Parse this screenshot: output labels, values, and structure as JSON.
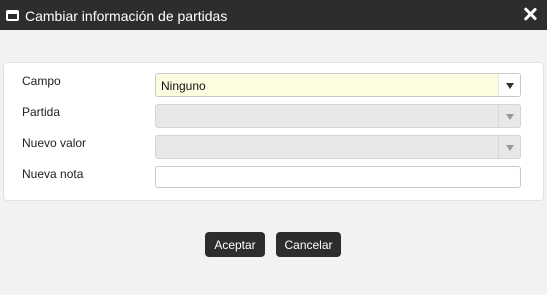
{
  "dialog": {
    "title": "Cambiar información de partidas"
  },
  "form": {
    "campo": {
      "label": "Campo",
      "value": "Ninguno"
    },
    "partida": {
      "label": "Partida",
      "value": ""
    },
    "nuevo_valor": {
      "label": "Nuevo valor",
      "value": ""
    },
    "nueva_nota": {
      "label": "Nueva nota",
      "value": ""
    }
  },
  "buttons": {
    "accept": "Aceptar",
    "cancel": "Cancelar"
  }
}
